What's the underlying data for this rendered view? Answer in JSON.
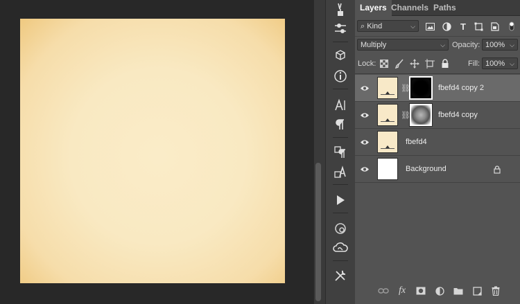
{
  "panel": {
    "tabs": [
      {
        "label": "Layers",
        "active": true
      },
      {
        "label": "Channels",
        "active": false
      },
      {
        "label": "Paths",
        "active": false
      }
    ],
    "filter": {
      "kind_label": "Kind",
      "icons": [
        "image-filter-icon",
        "adjustment-filter-icon",
        "type-filter-icon",
        "shape-filter-icon",
        "smart-object-filter-icon",
        "filter-toggle-icon"
      ]
    },
    "blend_mode": "Multiply",
    "opacity_label": "Opacity:",
    "opacity_value": "100%",
    "lock_label": "Lock:",
    "fill_label": "Fill:",
    "fill_value": "100%",
    "layers": [
      {
        "name": "fbefd4 copy 2",
        "visible": true,
        "selected": true,
        "mask": "black"
      },
      {
        "name": "fbefd4 copy",
        "visible": true,
        "selected": false,
        "mask": "gray"
      },
      {
        "name": "fbefd4",
        "visible": true,
        "selected": false,
        "mask": "none"
      },
      {
        "name": "Background",
        "visible": true,
        "selected": false,
        "mask": "none",
        "locked": true
      }
    ],
    "bottom_icons": [
      "link-layers-icon",
      "fx-icon",
      "add-mask-icon",
      "adjustment-layer-icon",
      "new-group-icon",
      "new-layer-icon",
      "trash-icon"
    ],
    "fx_label": "fx"
  },
  "colors": {
    "document_center": "#faecc8",
    "document_edge": "#efc980",
    "panel_bg": "#535353",
    "selected_row": "#6a6a6a"
  }
}
